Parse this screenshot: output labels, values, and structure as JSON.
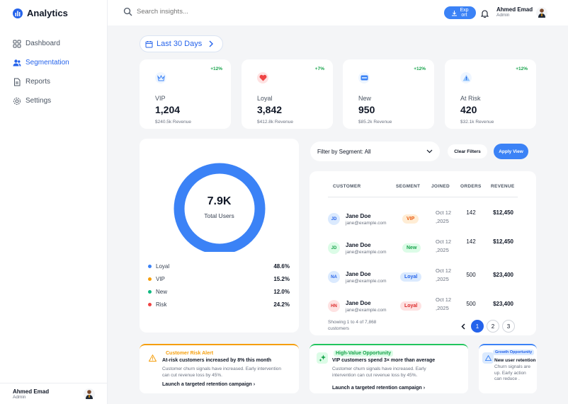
{
  "app": {
    "name": "Analytics"
  },
  "nav": [
    {
      "label": "Dashboard",
      "icon": "dashboard-icon"
    },
    {
      "label": "Segmentation",
      "icon": "users-icon",
      "active": true
    },
    {
      "label": "Reports",
      "icon": "reports-icon"
    },
    {
      "label": "Settings",
      "icon": "gear-icon"
    }
  ],
  "user": {
    "name": "Ahmed Emad",
    "role": "Admin"
  },
  "header": {
    "search_placeholder": "Search insights...",
    "export_label": "Export"
  },
  "date_range": "Last 30 Days",
  "stats": [
    {
      "label": "VIP",
      "value": "1,204",
      "revenue": "$240.5k Revenue",
      "change": "+12%",
      "icon": "crown-icon"
    },
    {
      "label": "Loyal",
      "value": "3,842",
      "revenue": "$412.8k Revenue",
      "change": "+7%",
      "icon": "heart-icon"
    },
    {
      "label": "New",
      "value": "950",
      "revenue": "$85.2k Revenue",
      "change": "+12%",
      "icon": "new-badge-icon"
    },
    {
      "label": "At Risk",
      "value": "420",
      "revenue": "$32.1k Revenue",
      "change": "+12%",
      "icon": "warning-icon"
    }
  ],
  "donut": {
    "total": "7.9K",
    "total_label": "Total Users",
    "legend": [
      {
        "label": "Loyal",
        "value": "48.6%",
        "color": "#3b82f6"
      },
      {
        "label": "VIP",
        "value": "15.2%",
        "color": "#f59e0b"
      },
      {
        "label": "New",
        "value": "12.0%",
        "color": "#10b981"
      },
      {
        "label": "Risk",
        "value": "24.2%",
        "color": "#ef4444"
      }
    ]
  },
  "filters": {
    "segment_label": "Filter by Segment: All",
    "clear_label": "Clear Filters",
    "apply_label": "Apply View"
  },
  "table": {
    "headers": [
      "CUSTOMER",
      "SEGMENT",
      "JOINED",
      "ORDERS",
      "REVENUE"
    ],
    "rows": [
      {
        "initials": "JD",
        "name": "Jane Doe",
        "email": "jane@example.com",
        "segment": "VIP",
        "joined": "Oct 12 ,2025",
        "orders": "142",
        "revenue": "$12,450"
      },
      {
        "initials": "JD",
        "name": "Jane Doe",
        "email": "jane@example.com",
        "segment": "New",
        "joined": "Oct 12 ,2025",
        "orders": "142",
        "revenue": "$12,450"
      },
      {
        "initials": "NA",
        "name": "Jane Doe",
        "email": "jane@example.com",
        "segment": "Loyal",
        "joined": "Oct 12 ,2025",
        "orders": "500",
        "revenue": "$23,400"
      },
      {
        "initials": "HN",
        "name": "Jane Doe",
        "email": "jane@example.com",
        "segment": "Loyal",
        "joined": "Oct 12 ,2025",
        "orders": "500",
        "revenue": "$23,400"
      }
    ],
    "showing": "Showing 1 to 4 of 7,868 customers",
    "pages": [
      "1",
      "2",
      "3"
    ],
    "current_page": "1"
  },
  "alerts": [
    {
      "tag": "Customer Risk Alert",
      "headline": "At-risk customers increased by 8% this month",
      "body": "Customer churn signals have increased. Early intervention can cut revenue loss by 45%.",
      "link": "Launch a targeted retention campaign",
      "color": "#f59e0b",
      "icon": "warning-icon"
    },
    {
      "tag": "High-Value Opportunity",
      "headline": "VIP customers spend 3× more than average",
      "body": "Customer churn signals have increased. Early intervention can cut revenue loss by 45%.",
      "link": "Launch a targeted retention campaign",
      "color": "#22c55e",
      "icon": "sparkle-icon"
    },
    {
      "tag": "Growth Opportunity",
      "headline": "New user retention",
      "body": "Churn signals are up. Early action can reduce .",
      "color": "#3b82f6",
      "icon": "warning-icon"
    }
  ]
}
